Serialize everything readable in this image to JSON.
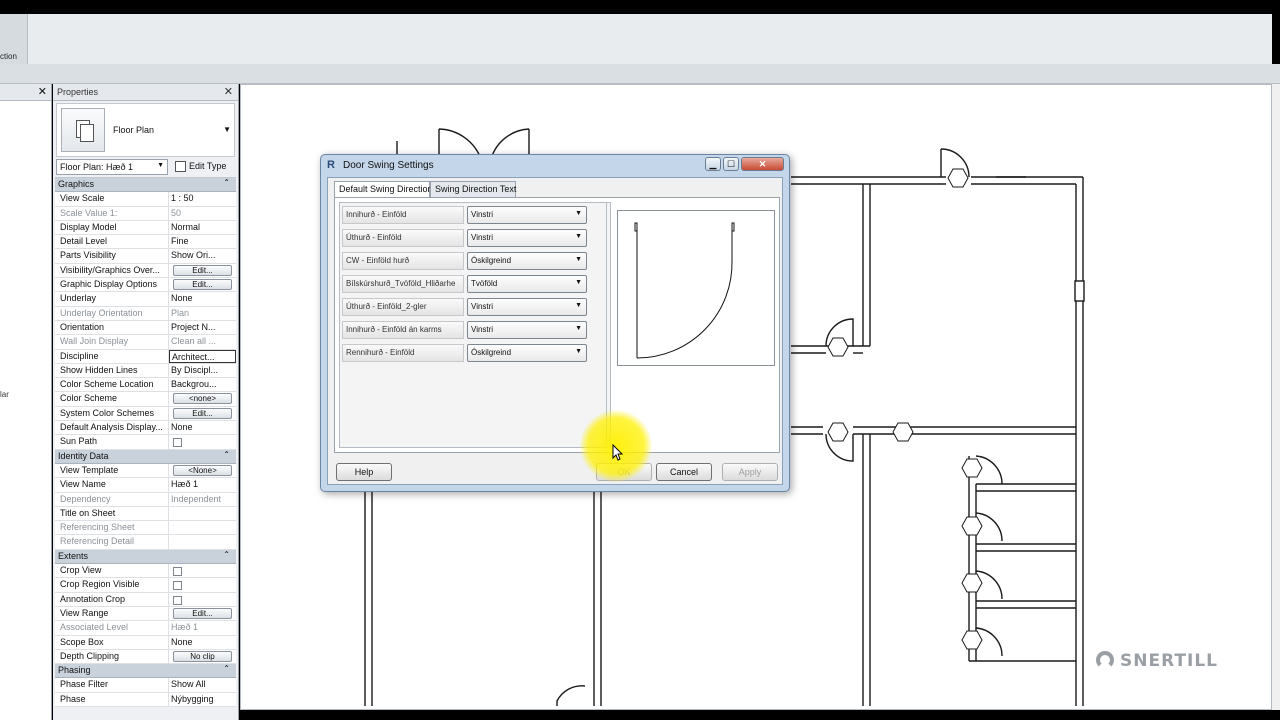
{
  "ribbon": {
    "tab_fragment": "ction"
  },
  "left_panel": {
    "fragment": "lar"
  },
  "properties": {
    "title": "Properties",
    "type_name": "Floor Plan",
    "instance_selector": "Floor Plan: Hæð 1",
    "edit_type_label": "Edit Type",
    "groups": [
      {
        "name": "Graphics",
        "rows": [
          {
            "key": "View Scale",
            "value": "1 : 50"
          },
          {
            "key": "Scale Value    1:",
            "value": "50",
            "dim": true
          },
          {
            "key": "Display Model",
            "value": "Normal"
          },
          {
            "key": "Detail Level",
            "value": "Fine"
          },
          {
            "key": "Parts Visibility",
            "value": "Show Ori..."
          },
          {
            "key": "Visibility/Graphics Over...",
            "value": "Edit...",
            "button": true
          },
          {
            "key": "Graphic Display Options",
            "value": "Edit...",
            "button": true
          },
          {
            "key": "Underlay",
            "value": "None"
          },
          {
            "key": "Underlay Orientation",
            "value": "Plan",
            "dim": true
          },
          {
            "key": "Orientation",
            "value": "Project N..."
          },
          {
            "key": "Wall Join Display",
            "value": "Clean all ...",
            "dim": true
          },
          {
            "key": "Discipline",
            "value": "Architect...",
            "boxed": true
          },
          {
            "key": "Show Hidden Lines",
            "value": "By Discipl..."
          },
          {
            "key": "Color Scheme Location",
            "value": "Backgrou..."
          },
          {
            "key": "Color Scheme",
            "value": "<none>",
            "button": true
          },
          {
            "key": "System Color Schemes",
            "value": "Edit...",
            "button": true
          },
          {
            "key": "Default Analysis Display...",
            "value": "None"
          },
          {
            "key": "Sun Path",
            "value": "",
            "checkbox": true
          }
        ]
      },
      {
        "name": "Identity Data",
        "rows": [
          {
            "key": "View Template",
            "value": "<None>",
            "button": true
          },
          {
            "key": "View Name",
            "value": "Hæð 1"
          },
          {
            "key": "Dependency",
            "value": "Independent",
            "dim": true
          },
          {
            "key": "Title on Sheet",
            "value": ""
          },
          {
            "key": "Referencing Sheet",
            "value": "",
            "dim": true
          },
          {
            "key": "Referencing Detail",
            "value": "",
            "dim": true
          }
        ]
      },
      {
        "name": "Extents",
        "rows": [
          {
            "key": "Crop View",
            "value": "",
            "checkbox": true
          },
          {
            "key": "Crop Region Visible",
            "value": "",
            "checkbox": true
          },
          {
            "key": "Annotation Crop",
            "value": "",
            "checkbox": true
          },
          {
            "key": "View Range",
            "value": "Edit...",
            "button": true
          },
          {
            "key": "Associated Level",
            "value": "Hæð 1",
            "dim": true
          },
          {
            "key": "Scope Box",
            "value": "None"
          },
          {
            "key": "Depth Clipping",
            "value": "No clip",
            "button": true
          }
        ]
      },
      {
        "name": "Phasing",
        "rows": [
          {
            "key": "Phase Filter",
            "value": "Show All"
          },
          {
            "key": "Phase",
            "value": "Nýbygging"
          }
        ]
      }
    ]
  },
  "dialog": {
    "title": "Door Swing Settings",
    "tabs": [
      "Default Swing Direction",
      "Swing Direction Text"
    ],
    "rows": [
      {
        "label": "Innihurð - Einföld",
        "value": "Vinstri"
      },
      {
        "label": "Úthurð - Einföld",
        "value": "Vinstri"
      },
      {
        "label": "CW - Einföld hurð",
        "value": "Óskilgreind"
      },
      {
        "label": "Bílskúrshurð_Tvöföld_Hliðarhe",
        "value": "Tvöföld"
      },
      {
        "label": "Úthurð - Einföld_2-gler",
        "value": "Vinstri"
      },
      {
        "label": "Innihurð - Einföld án karms",
        "value": "Vinstri"
      },
      {
        "label": "Rennihurð - Einföld",
        "value": "Óskilgreind"
      }
    ],
    "buttons": {
      "help": "Help",
      "ok": "OK",
      "cancel": "Cancel",
      "apply": "Apply"
    }
  },
  "watermark": "SNERTILL"
}
